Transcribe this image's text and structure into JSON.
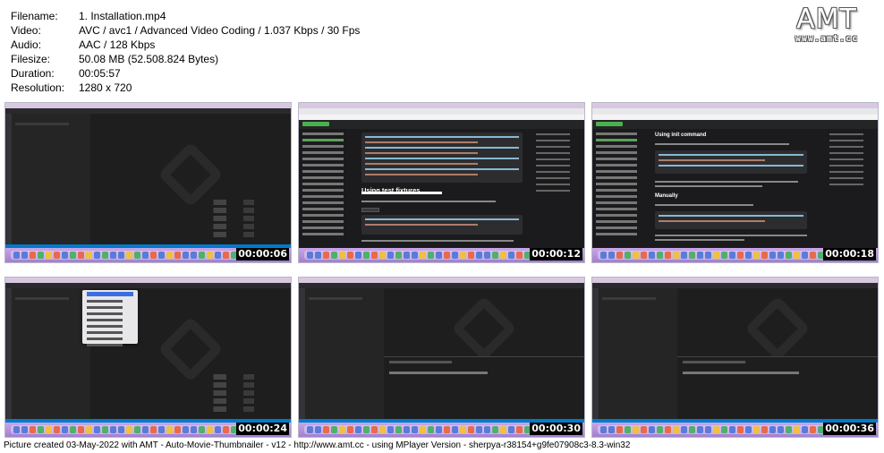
{
  "metadata": [
    {
      "label": "Filename:",
      "value": "1. Installation.mp4"
    },
    {
      "label": "Video:",
      "value": "AVC / avc1 / Advanced Video Coding / 1.037 Kbps / 30 Fps"
    },
    {
      "label": "Audio:",
      "value": "AAC / 128 Kbps"
    },
    {
      "label": "Filesize:",
      "value": "50.08 MB (52.508.824 Bytes)"
    },
    {
      "label": "Duration:",
      "value": "00:05:57"
    },
    {
      "label": "Resolution:",
      "value": "1280 x 720"
    }
  ],
  "logo": {
    "main": "AMT",
    "sub": "www.amt.cc"
  },
  "thumbnails": [
    {
      "timestamp": "00:00:06",
      "scene": "vscode-empty"
    },
    {
      "timestamp": "00:00:12",
      "scene": "docs-fixtures"
    },
    {
      "timestamp": "00:00:18",
      "scene": "docs-init"
    },
    {
      "timestamp": "00:00:24",
      "scene": "vscode-menu"
    },
    {
      "timestamp": "00:00:30",
      "scene": "vscode-terminal"
    },
    {
      "timestamp": "00:00:36",
      "scene": "vscode-terminal"
    }
  ],
  "docs": {
    "heading_fixtures": "Using test fixtures",
    "heading_init": "Using init command",
    "heading_manually": "Manually"
  },
  "footer": "Picture created 03-May-2022 with AMT - Auto-Movie-Thumbnailer - v12 - http://www.amt.cc - using MPlayer Version - sherpya-r38154+g9fe07908c3-8.3-win32"
}
